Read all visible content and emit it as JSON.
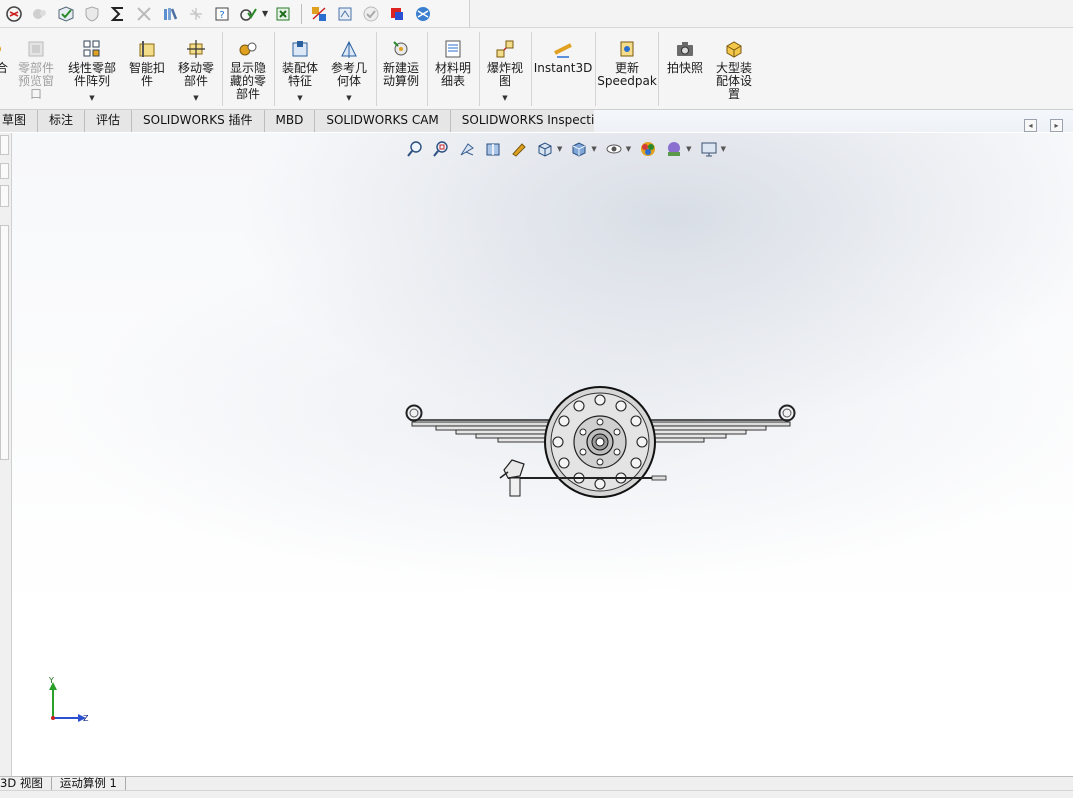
{
  "quick_toolbar": {
    "icons": [
      "sw-logo-icon",
      "ghost-component-icon",
      "check-assembly-icon",
      "shield-icon",
      "sigma-icon",
      "interference-icon",
      "books-icon",
      "flash-icon",
      "help-icon",
      "settings-check-icon",
      "caret-down-icon",
      "excel-icon",
      "assembly-icons-icon",
      "visualize-icon",
      "check-icon",
      "red-square-icon",
      "globe-icon"
    ]
  },
  "ribbon": {
    "items": [
      {
        "label": "合",
        "dim": false
      },
      {
        "label": "零部件\n预览窗\n口",
        "dim": true
      },
      {
        "label": "线性零部\n件阵列",
        "dim": false
      },
      {
        "label": "智能扣\n件",
        "dim": false
      },
      {
        "label": "移动零\n部件",
        "dim": false
      },
      {
        "label": "显示隐\n藏的零\n部件",
        "dim": false
      },
      {
        "label": "装配体\n特征",
        "dim": false
      },
      {
        "label": "参考几\n何体",
        "dim": false
      },
      {
        "label": "新建运\n动算例",
        "dim": false
      },
      {
        "label": "材料明\n细表",
        "dim": false
      },
      {
        "label": "爆炸视\n图",
        "dim": false
      },
      {
        "label": "Instant3D",
        "dim": false
      },
      {
        "label": "更新\nSpeedpak",
        "dim": false
      },
      {
        "label": "拍快照",
        "dim": false
      },
      {
        "label": "大型装\n配体设\n置",
        "dim": false
      }
    ]
  },
  "tabs": [
    "草图",
    "标注",
    "评估",
    "SOLIDWORKS 插件",
    "MBD",
    "SOLIDWORKS CAM",
    "SOLIDWORKS Inspection"
  ],
  "triad": {
    "y_label": "Y",
    "z_label": "Z"
  },
  "bottom_tabs": [
    "3D 视图",
    "运动算例 1"
  ],
  "colors": {
    "accent": "#1a6fd0",
    "triad_y": "#2aa02a",
    "triad_z": "#2a4fd0",
    "tab_bg": "#e6e6e6"
  }
}
